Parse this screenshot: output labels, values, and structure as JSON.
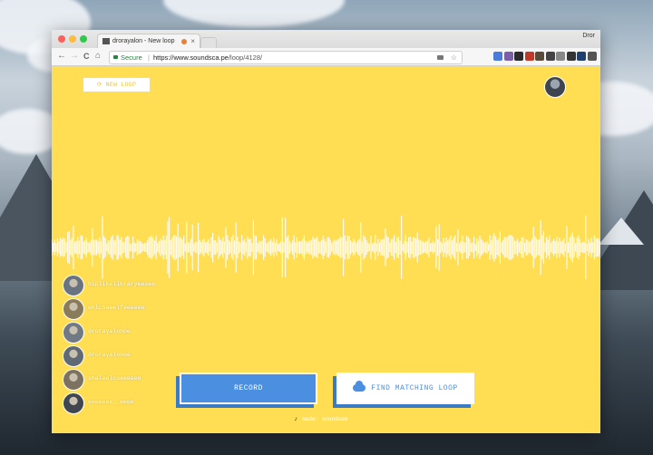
{
  "browser": {
    "tab_title": "drorayalon - New loop",
    "tab_close": "×",
    "user_name": "Dror",
    "nav": {
      "back": "←",
      "forward": "→",
      "reload": "C",
      "home": "⌂"
    },
    "address": {
      "secure_label": "Secure",
      "separator": "|",
      "url_host": "https://www.soundsca.pe",
      "url_path": "/loop/4128/",
      "star": "☆"
    },
    "extension_colors": [
      "#4a7bd8",
      "#7b5fa8",
      "#2b2b2b",
      "#c0392b",
      "#5a4a3a",
      "#444444",
      "#888888",
      "#333333",
      "#1f3f6f",
      "#555555"
    ]
  },
  "page": {
    "new_loop_icon": "⟳",
    "new_loop_label": "NEW LOOP",
    "users": [
      {
        "name": "hiplikelibraryeesee",
        "color": "#6a7480"
      },
      {
        "name": "ehlchaeelfeeeeee",
        "color": "#8a7b5a"
      },
      {
        "name": "drorayalonoe",
        "color": "#707a84"
      },
      {
        "name": "drorayalonoe",
        "color": "#5f6a74"
      },
      {
        "name": "sheleelcoeeeeee",
        "color": "#7d7260"
      },
      {
        "name": "eeeeeee__eeee",
        "color": "#3f4650"
      }
    ],
    "record_label": "RECORD",
    "find_label": "FIND MATCHING LOOP",
    "footer_icon": "♪",
    "footer_text": "made: soundsee"
  },
  "colors": {
    "background": "#ffde53",
    "accent_blue": "#4a8fe0",
    "waveform": "#ffffff"
  }
}
